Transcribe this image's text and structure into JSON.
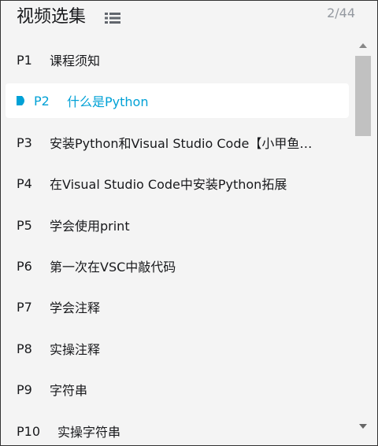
{
  "header": {
    "title": "视频选集",
    "count": "2/44",
    "list_icon": "list-icon"
  },
  "episodes": [
    {
      "p": "P1",
      "title": "课程须知",
      "active": false
    },
    {
      "p": "P2",
      "title": "什么是Python",
      "active": true
    },
    {
      "p": "P3",
      "title": "安装Python和Visual Studio Code【小甲鱼…",
      "active": false
    },
    {
      "p": "P4",
      "title": "在Visual Studio Code中安装Python拓展",
      "active": false
    },
    {
      "p": "P5",
      "title": "学会使用print",
      "active": false
    },
    {
      "p": "P6",
      "title": "第一次在VSC中敲代码",
      "active": false
    },
    {
      "p": "P7",
      "title": "学会注释",
      "active": false
    },
    {
      "p": "P8",
      "title": "实操注释",
      "active": false
    },
    {
      "p": "P9",
      "title": "字符串",
      "active": false
    },
    {
      "p": "P10",
      "title": "实操字符串",
      "active": false
    }
  ],
  "colors": {
    "accent": "#00a1d6",
    "text": "#18191c",
    "muted": "#9499a0",
    "panel_bg": "#f4f4f4"
  },
  "icons": {
    "playing": "play-indicator-icon",
    "scroll_up": "scroll-up-arrow-icon",
    "scroll_down": "scroll-down-arrow-icon"
  }
}
